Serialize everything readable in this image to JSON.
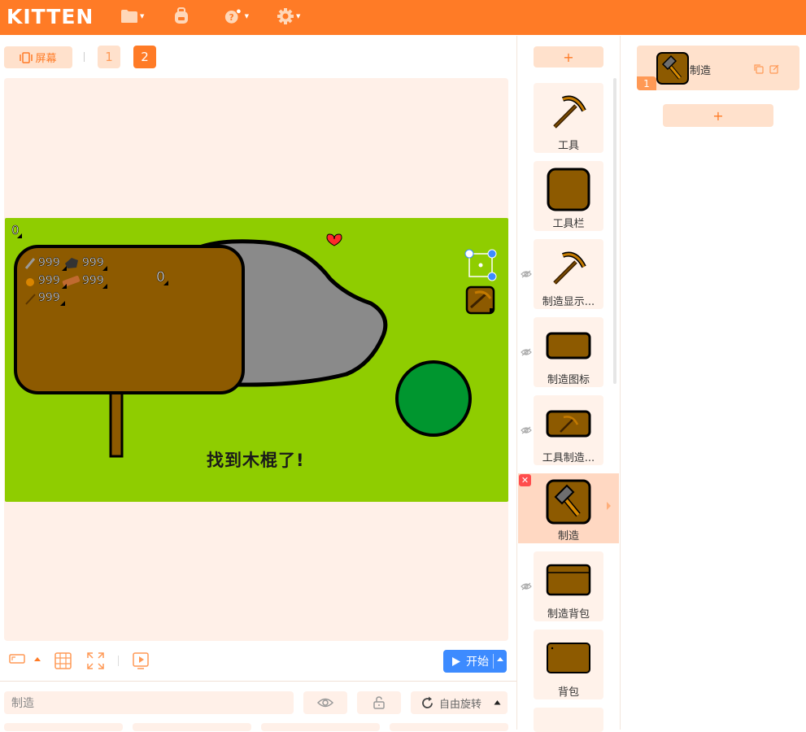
{
  "app": {
    "logo": "KITTEN"
  },
  "topbar": {
    "icons": [
      "folder-icon",
      "backpack-icon",
      "help-icon",
      "settings-icon"
    ]
  },
  "screen": {
    "screen_button": "屏幕",
    "screens": [
      "1",
      "2"
    ],
    "active_screen": "2"
  },
  "game": {
    "top_left_counter": "0",
    "inventory": [
      {
        "icon": "stick-icon",
        "value": "999"
      },
      {
        "icon": "stone-icon",
        "value": "999"
      },
      {
        "icon": "torch-icon",
        "value": "999"
      },
      {
        "icon": "plank-icon",
        "value": "999"
      },
      {
        "icon": "thin-stick-icon",
        "value": "999"
      }
    ],
    "sign_counter": "0",
    "message": "找到木棍了!"
  },
  "stage_toolbar": {
    "start_label": "开始"
  },
  "properties": {
    "sprite_name": "制造",
    "rotation_label": "自由旋转"
  },
  "sprites": {
    "add_label": "+",
    "items": [
      {
        "label": "工具",
        "icon": "pickaxe-icon",
        "hidden": false
      },
      {
        "label": "工具栏",
        "icon": "brown-square-icon",
        "hidden": false
      },
      {
        "label": "制造显示...",
        "icon": "pickaxe-icon",
        "hidden": true
      },
      {
        "label": "制造图标",
        "icon": "brown-rect-icon",
        "hidden": true
      },
      {
        "label": "工具制造...",
        "icon": "pickaxe-small-icon",
        "hidden": true
      },
      {
        "label": "制造",
        "icon": "hammer-icon",
        "hidden": false,
        "selected": true
      },
      {
        "label": "制造背包",
        "icon": "brown-bag-icon",
        "hidden": true
      },
      {
        "label": "背包",
        "icon": "brown-bag-icon",
        "hidden": false
      }
    ]
  },
  "costumes": {
    "items": [
      {
        "number": "1",
        "name": "制造"
      }
    ],
    "add_label": "+"
  },
  "colors": {
    "brand": "#ff7b26",
    "game_bg": "#8fcd00",
    "start": "#3d8bff"
  }
}
